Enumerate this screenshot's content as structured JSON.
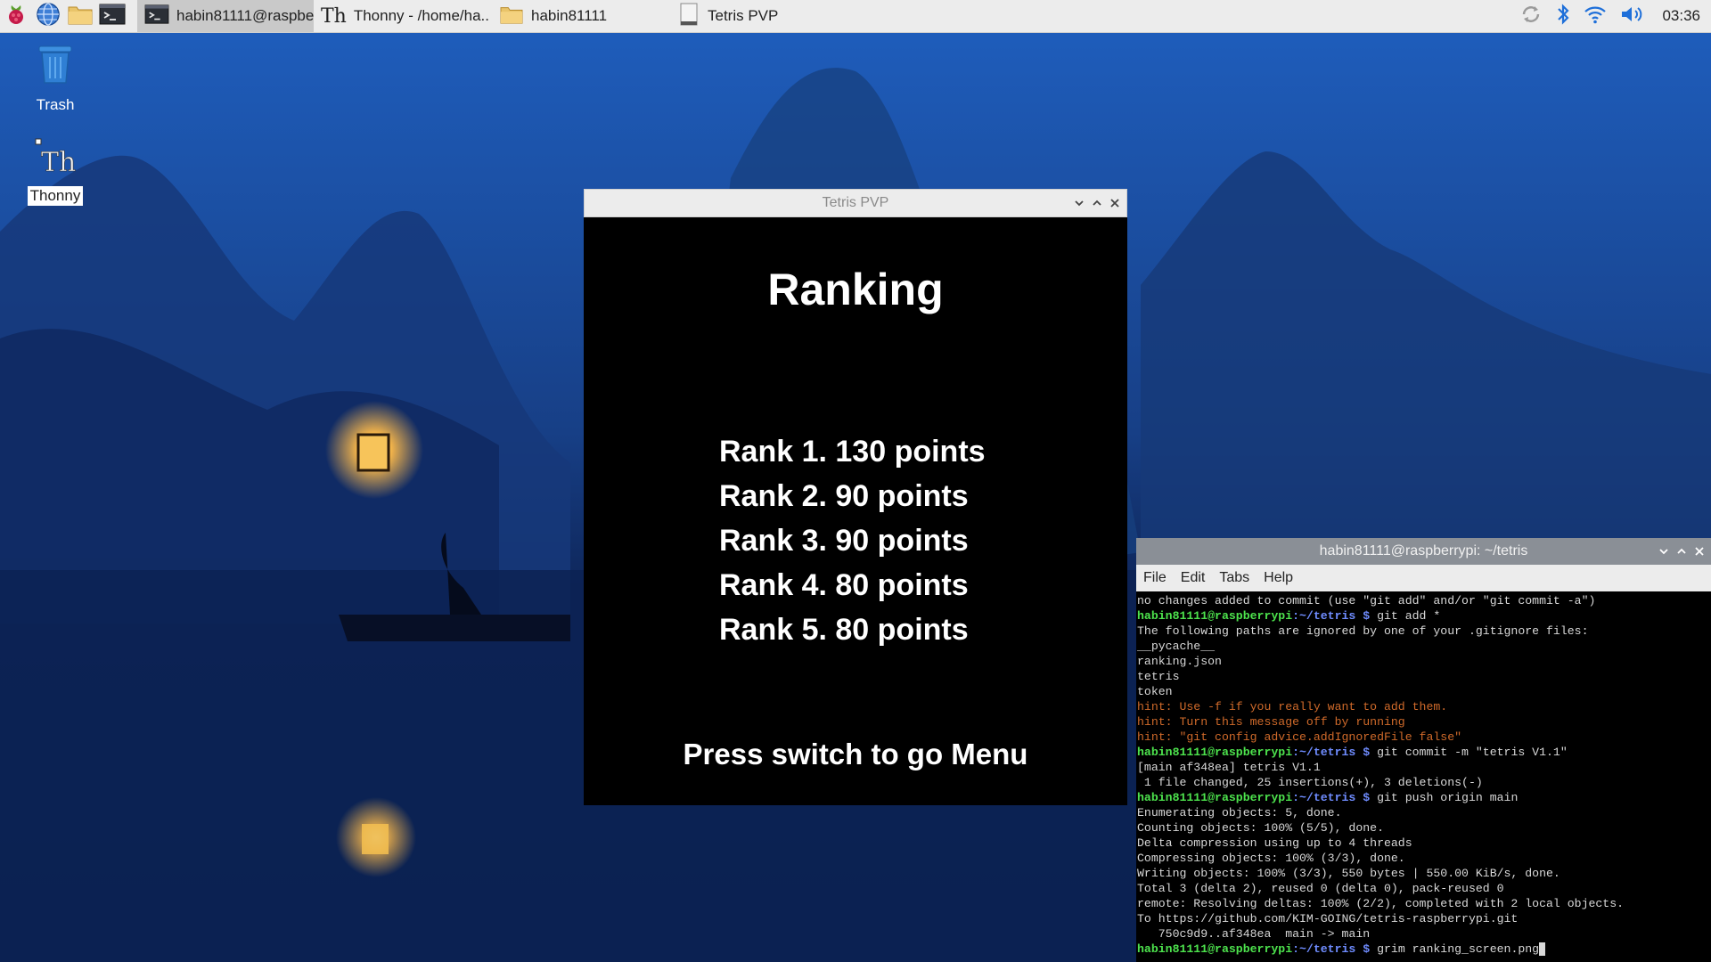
{
  "colors": {
    "taskbar_bg": "#ececec",
    "game_bg": "#000000",
    "term_title_bg": "#8a8f96",
    "prompt_user": "#4de34d",
    "prompt_path": "#6f8cff",
    "hint": "#d06a2a"
  },
  "taskbar": {
    "launchers": [
      {
        "icon": "raspberry-menu-icon"
      },
      {
        "icon": "web-browser-icon"
      },
      {
        "icon": "file-manager-icon"
      },
      {
        "icon": "terminal-icon"
      }
    ],
    "tasks": [
      {
        "icon": "terminal-icon",
        "label": "habin81111@raspbe..",
        "active": true
      },
      {
        "icon": "thonny-icon",
        "label": "Thonny  -  /home/ha.."
      },
      {
        "icon": "folder-icon",
        "label": "habin81111"
      },
      {
        "icon": "window-icon",
        "label": "Tetris PVP"
      }
    ],
    "tray": [
      "sync-icon",
      "bluetooth-icon",
      "wifi-icon",
      "volume-icon"
    ],
    "clock": "03:36"
  },
  "desktop": {
    "icons": [
      {
        "icon": "trash-icon",
        "label": "Trash"
      },
      {
        "icon": "thonny-icon",
        "label": "Thonny",
        "selected": true
      }
    ]
  },
  "game_window": {
    "title": "Tetris PVP",
    "heading": "Ranking",
    "ranks": [
      "Rank 1. 130 points",
      "Rank 2. 90 points",
      "Rank 3. 90 points",
      "Rank 4. 80 points",
      "Rank 5. 80 points"
    ],
    "footer": "Press switch to go Menu"
  },
  "terminal": {
    "title": "habin81111@raspberrypi: ~/tetris",
    "menu": [
      "File",
      "Edit",
      "Tabs",
      "Help"
    ],
    "prompt_user": "habin81111@raspberrypi",
    "prompt_path": ":~/tetris",
    "prompt_symbol": " $ ",
    "lines": [
      {
        "type": "out",
        "text": "no changes added to commit (use \"git add\" and/or \"git commit -a\")"
      },
      {
        "type": "cmd",
        "text": "git add *"
      },
      {
        "type": "out",
        "text": "The following paths are ignored by one of your .gitignore files:"
      },
      {
        "type": "out",
        "text": "__pycache__"
      },
      {
        "type": "out",
        "text": "ranking.json"
      },
      {
        "type": "out",
        "text": "tetris"
      },
      {
        "type": "out",
        "text": "token"
      },
      {
        "type": "hint",
        "text": "hint: Use -f if you really want to add them."
      },
      {
        "type": "hint",
        "text": "hint: Turn this message off by running"
      },
      {
        "type": "hint",
        "text": "hint: \"git config advice.addIgnoredFile false\""
      },
      {
        "type": "cmd",
        "text": "git commit -m \"tetris V1.1\""
      },
      {
        "type": "out",
        "text": "[main af348ea] tetris V1.1"
      },
      {
        "type": "out",
        "text": " 1 file changed, 25 insertions(+), 3 deletions(-)"
      },
      {
        "type": "cmd",
        "text": "git push origin main"
      },
      {
        "type": "out",
        "text": "Enumerating objects: 5, done."
      },
      {
        "type": "out",
        "text": "Counting objects: 100% (5/5), done."
      },
      {
        "type": "out",
        "text": "Delta compression using up to 4 threads"
      },
      {
        "type": "out",
        "text": "Compressing objects: 100% (3/3), done."
      },
      {
        "type": "out",
        "text": "Writing objects: 100% (3/3), 550 bytes | 550.00 KiB/s, done."
      },
      {
        "type": "out",
        "text": "Total 3 (delta 2), reused 0 (delta 0), pack-reused 0"
      },
      {
        "type": "out",
        "text": "remote: Resolving deltas: 100% (2/2), completed with 2 local objects."
      },
      {
        "type": "out",
        "text": "To https://github.com/KIM-GOING/tetris-raspberrypi.git"
      },
      {
        "type": "out",
        "text": "   750c9d9..af348ea  main -> main"
      },
      {
        "type": "cmd",
        "text": "grim ranking_screen.png",
        "cursor": true
      }
    ]
  }
}
